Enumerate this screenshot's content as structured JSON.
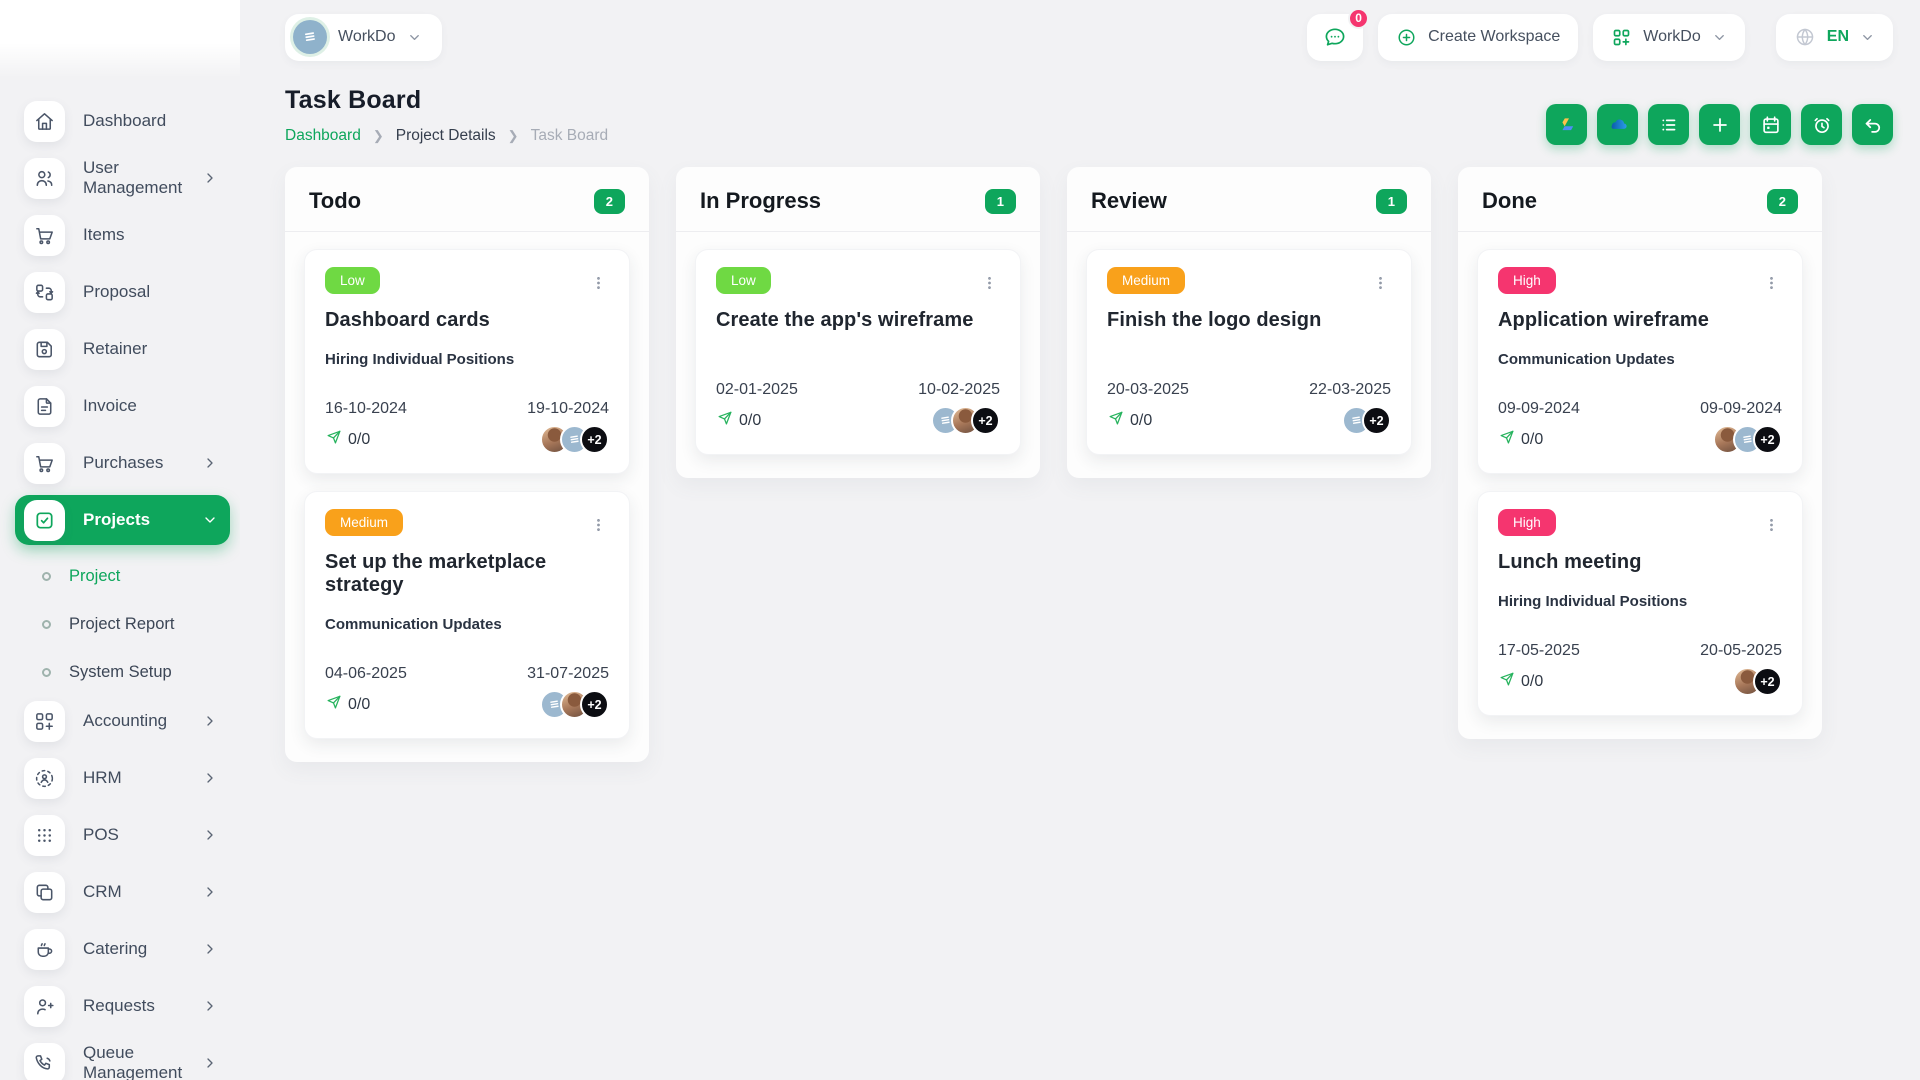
{
  "theme": {
    "accent": "#0ea65c",
    "low": "#6fd943",
    "medium": "#f9a11b",
    "high": "#f5356f"
  },
  "topbar": {
    "workspace": {
      "label": "WorkDo",
      "avatar": "workdo-logo"
    },
    "chat": {
      "badge": "0"
    },
    "create_workspace": {
      "label": "Create Workspace"
    },
    "app_switcher": {
      "label": "WorkDo"
    },
    "language": {
      "code": "EN"
    }
  },
  "page": {
    "title": "Task Board",
    "breadcrumb": [
      {
        "label": "Dashboard",
        "type": "link"
      },
      {
        "label": "Project Details",
        "type": "mid"
      },
      {
        "label": "Task Board",
        "type": "current"
      }
    ]
  },
  "toolbar": {
    "buttons": [
      {
        "name": "google-drive"
      },
      {
        "name": "onedrive"
      },
      {
        "name": "list"
      },
      {
        "name": "add"
      },
      {
        "name": "calendar"
      },
      {
        "name": "timer"
      },
      {
        "name": "undo"
      }
    ]
  },
  "sidebar": {
    "items": [
      {
        "label": "Dashboard",
        "icon": "home",
        "chevron": false
      },
      {
        "label": "User Management",
        "icon": "users",
        "chevron": true
      },
      {
        "label": "Items",
        "icon": "cart",
        "chevron": false
      },
      {
        "label": "Proposal",
        "icon": "proposal",
        "chevron": false
      },
      {
        "label": "Retainer",
        "icon": "retainer",
        "chevron": false
      },
      {
        "label": "Invoice",
        "icon": "invoice",
        "chevron": false
      },
      {
        "label": "Purchases",
        "icon": "cart",
        "chevron": true
      },
      {
        "label": "Projects",
        "icon": "projects",
        "chevron": "down",
        "active": true,
        "submenu": [
          {
            "label": "Project",
            "active": true
          },
          {
            "label": "Project Report",
            "active": false
          },
          {
            "label": "System Setup",
            "active": false
          }
        ]
      },
      {
        "label": "Accounting",
        "icon": "accounting",
        "chevron": true
      },
      {
        "label": "HRM",
        "icon": "hrm",
        "chevron": true
      },
      {
        "label": "POS",
        "icon": "pos",
        "chevron": true
      },
      {
        "label": "CRM",
        "icon": "crm",
        "chevron": true
      },
      {
        "label": "Catering",
        "icon": "catering",
        "chevron": true
      },
      {
        "label": "Requests",
        "icon": "requests",
        "chevron": true
      },
      {
        "label": "Queue Management",
        "icon": "queue",
        "chevron": true
      }
    ]
  },
  "board": {
    "columns": [
      {
        "title": "Todo",
        "count": "2",
        "cards": [
          {
            "priority": "Low",
            "level": "low",
            "title": "Dashboard cards",
            "milestone": "Hiring Individual Positions",
            "start_date": "16-10-2024",
            "end_date": "19-10-2024",
            "progress": "0/0",
            "avatars": [
              "photo",
              "logo"
            ],
            "more": "+2"
          },
          {
            "priority": "Medium",
            "level": "medium",
            "title": "Set up the marketplace strategy",
            "milestone": "Communication Updates",
            "start_date": "04-06-2025",
            "end_date": "31-07-2025",
            "progress": "0/0",
            "avatars": [
              "logo",
              "photo"
            ],
            "more": "+2"
          }
        ]
      },
      {
        "title": "In Progress",
        "count": "1",
        "cards": [
          {
            "priority": "Low",
            "level": "low",
            "title": "Create the app's wireframe",
            "milestone": "",
            "start_date": "02-01-2025",
            "end_date": "10-02-2025",
            "progress": "0/0",
            "avatars": [
              "logo",
              "photo"
            ],
            "more": "+2"
          }
        ]
      },
      {
        "title": "Review",
        "count": "1",
        "cards": [
          {
            "priority": "Medium",
            "level": "medium",
            "title": "Finish the logo design",
            "milestone": "",
            "start_date": "20-03-2025",
            "end_date": "22-03-2025",
            "progress": "0/0",
            "avatars": [
              "logo"
            ],
            "more": "+2"
          }
        ]
      },
      {
        "title": "Done",
        "count": "2",
        "cards": [
          {
            "priority": "High",
            "level": "high",
            "title": "Application wireframe",
            "milestone": "Communication Updates",
            "start_date": "09-09-2024",
            "end_date": "09-09-2024",
            "progress": "0/0",
            "avatars": [
              "photo",
              "logo"
            ],
            "more": "+2"
          },
          {
            "priority": "High",
            "level": "high",
            "title": "Lunch meeting",
            "milestone": "Hiring Individual Positions",
            "start_date": "17-05-2025",
            "end_date": "20-05-2025",
            "progress": "0/0",
            "avatars": [
              "photo"
            ],
            "more": "+2"
          }
        ]
      }
    ]
  }
}
